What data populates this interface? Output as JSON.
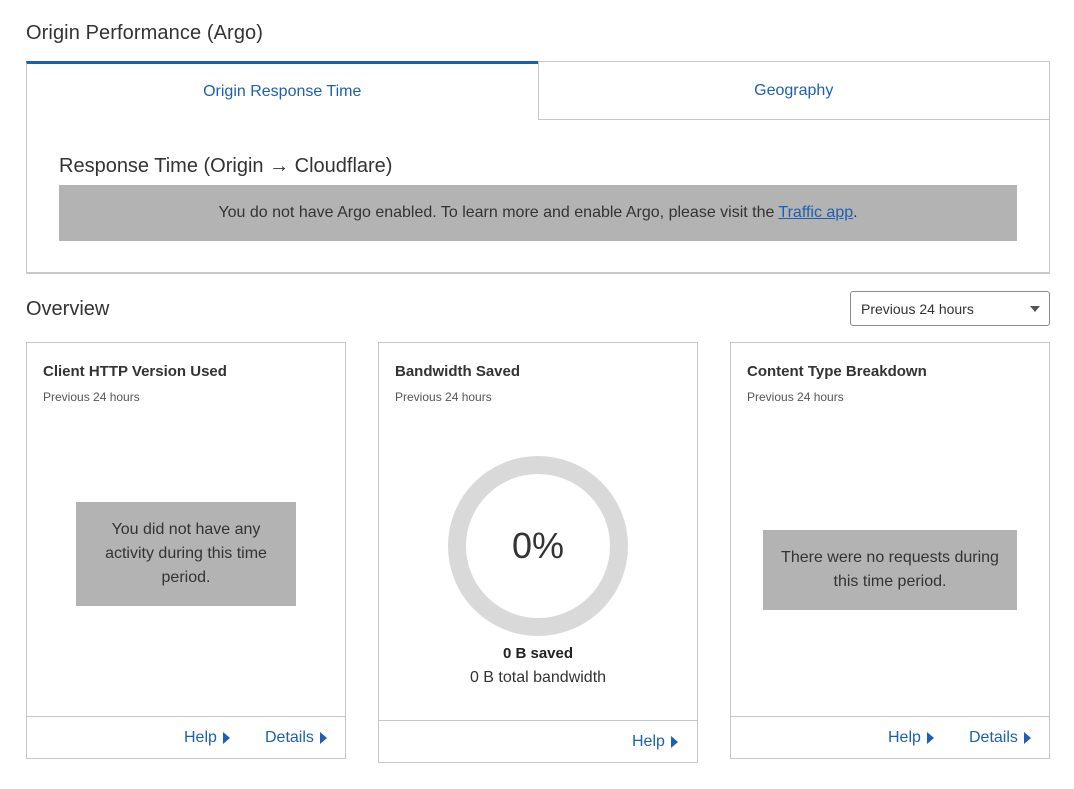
{
  "page": {
    "section_title": "Origin Performance (Argo)"
  },
  "argo": {
    "tabs": [
      {
        "label": "Origin Response Time",
        "active": true
      },
      {
        "label": "Geography",
        "active": false
      }
    ],
    "heading": "Response Time (Origin → Cloudflare)",
    "notice_text": "You do not have Argo enabled. To learn more and enable Argo, please visit the",
    "notice_link": "Traffic app",
    "notice_end": "."
  },
  "overview": {
    "title": "Overview",
    "range_selected": "Previous 24 hours"
  },
  "cards": {
    "http_version": {
      "title": "Client HTTP Version Used",
      "subtitle": "Previous 24 hours",
      "empty_message": "You did not have any activity during this time period.",
      "help_label": "Help",
      "details_label": "Details"
    },
    "bandwidth": {
      "title": "Bandwidth Saved",
      "subtitle": "Previous 24 hours",
      "percent_label": "0%",
      "percent_value": 0,
      "saved_label": "0 B saved",
      "total_label": "0 B total bandwidth",
      "help_label": "Help"
    },
    "content_type": {
      "title": "Content Type Breakdown",
      "subtitle": "Previous 24 hours",
      "empty_message": "There were no requests during this time period.",
      "help_label": "Help",
      "details_label": "Details"
    }
  },
  "colors": {
    "link": "#1d5fb3",
    "tab_active_border": "#1a5fb4",
    "notice_bg": "#b3b3b3",
    "donut_track": "#d9d9d9",
    "border": "#c8c8c8"
  },
  "icons": {
    "select_caret": "caret-down-icon",
    "link_arrow": "triangle-right-icon"
  }
}
